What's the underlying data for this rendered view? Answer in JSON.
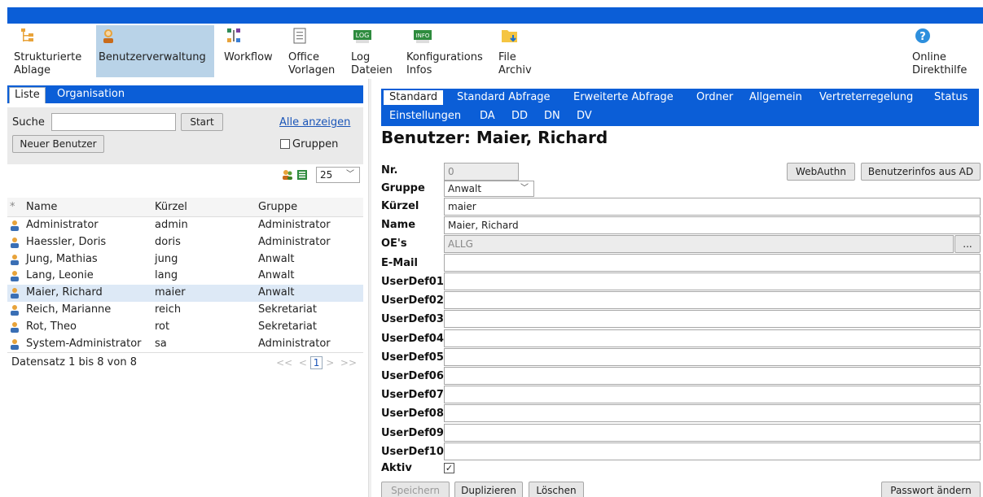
{
  "toolbar": {
    "items": [
      {
        "label": "Strukturierte\nAblage",
        "icon": "tree-icon"
      },
      {
        "label": "Benutzerverwaltung",
        "icon": "user-icon"
      },
      {
        "label": "Workflow",
        "icon": "workflow-icon"
      },
      {
        "label": "Office\nVorlagen",
        "icon": "document-icon"
      },
      {
        "label": "Log\nDateien",
        "icon": "log-icon"
      },
      {
        "label": "Konfigurations\nInfos",
        "icon": "info-icon"
      },
      {
        "label": "File\nArchiv",
        "icon": "folder-icon"
      },
      {
        "label": "Online\nDirekthilfe",
        "icon": "help-icon"
      }
    ]
  },
  "left": {
    "tabs": [
      "Liste",
      "Organisation"
    ],
    "search_label": "Suche",
    "search_value": "",
    "start_label": "Start",
    "show_all_label": "Alle anzeigen",
    "new_user_label": "Neuer Benutzer",
    "groups_label": "Gruppen",
    "page_size": "25",
    "columns": [
      "*",
      "Name",
      "Kürzel",
      "Gruppe"
    ],
    "rows": [
      {
        "name": "Administrator",
        "kuerzel": "admin",
        "gruppe": "Administrator"
      },
      {
        "name": "Haessler, Doris",
        "kuerzel": "doris",
        "gruppe": "Administrator"
      },
      {
        "name": "Jung, Mathias",
        "kuerzel": "jung",
        "gruppe": "Anwalt"
      },
      {
        "name": "Lang, Leonie",
        "kuerzel": "lang",
        "gruppe": "Anwalt"
      },
      {
        "name": "Maier, Richard",
        "kuerzel": "maier",
        "gruppe": "Anwalt"
      },
      {
        "name": "Reich, Marianne",
        "kuerzel": "reich",
        "gruppe": "Sekretariat"
      },
      {
        "name": "Rot, Theo",
        "kuerzel": "rot",
        "gruppe": "Sekretariat"
      },
      {
        "name": "System-Administrator",
        "kuerzel": "sa",
        "gruppe": "Administrator"
      }
    ],
    "selected_row": 4,
    "footer": "Datensatz 1 bis 8 von 8",
    "pager": {
      "first": "<<",
      "prev": "<",
      "current": "1",
      "next": ">",
      "last": ">>"
    }
  },
  "right": {
    "tabs_row1": [
      "Standard",
      "Standard Abfrage",
      "Erweiterte Abfrage",
      "Ordner",
      "Allgemein",
      "Vertreterregelung",
      "Status"
    ],
    "tabs_row2": [
      "Einstellungen",
      "DA",
      "DD",
      "DN",
      "DV"
    ],
    "title": "Benutzer: Maier, Richard",
    "webauthn_label": "WebAuthn",
    "ad_label": "Benutzerinfos aus AD",
    "fields": {
      "nr_label": "Nr.",
      "nr_value": "0",
      "gruppe_label": "Gruppe",
      "gruppe_value": "Anwalt",
      "kuerzel_label": "Kürzel",
      "kuerzel_value": "maier",
      "name_label": "Name",
      "name_value": "Maier, Richard",
      "oes_label": "OE's",
      "oes_value": "ALLG",
      "oes_button": "...",
      "email_label": "E-Mail",
      "email_value": "",
      "aktiv_label": "Aktiv"
    },
    "userdefs": [
      "UserDef01",
      "UserDef02",
      "UserDef03",
      "UserDef04",
      "UserDef05",
      "UserDef06",
      "UserDef07",
      "UserDef08",
      "UserDef09",
      "UserDef10"
    ],
    "buttons": {
      "save": "Speichern",
      "duplicate": "Duplizieren",
      "delete": "Löschen",
      "password": "Passwort ändern"
    }
  }
}
